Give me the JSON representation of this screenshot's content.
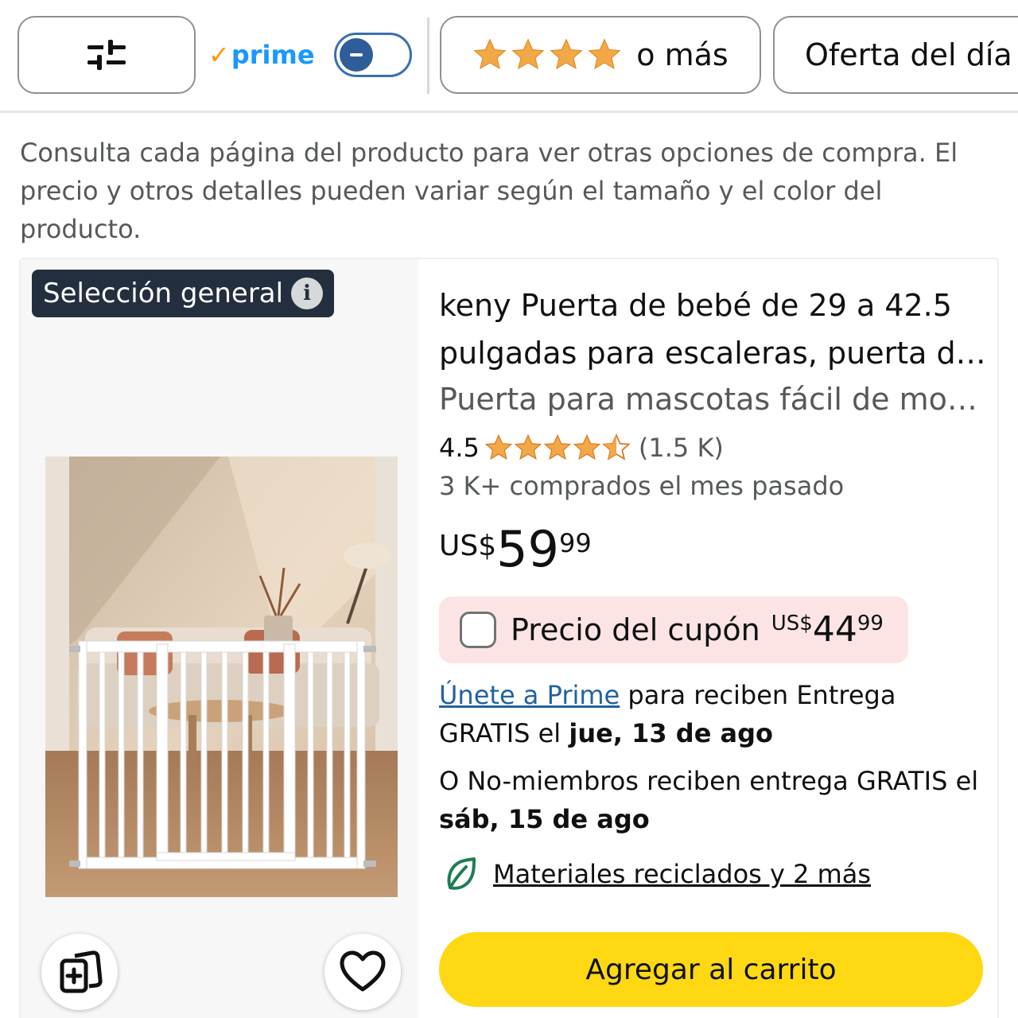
{
  "filter_bar": {
    "filters_icon": "sliders-icon",
    "prime_label": "prime",
    "prime_toggle_state": "off",
    "stars_label": "o más",
    "stars_count": 4,
    "deal_label": "Oferta del día"
  },
  "notice": "Consulta cada página del producto para ver otras opciones de compra. El precio y otros detalles pueden variar según el tamaño y el color del producto.",
  "product": {
    "badge": "Selección general",
    "title": "keny Puerta de bebé de 29 a 42.5 pulgadas para escaleras, puerta d…",
    "subtitle": "Puerta para mascotas fácil de mo…",
    "rating": "4.5",
    "rating_value": 4.5,
    "rating_count": "(1.5 K)",
    "bought": "3 K+ comprados el mes pasado",
    "price": {
      "symbol": "US$",
      "whole": "59",
      "fraction": "99"
    },
    "coupon": {
      "label": "Precio del cupón",
      "symbol": "US$",
      "whole": "44",
      "fraction": "99"
    },
    "delivery": {
      "prime_link": "Únete a Prime",
      "text1": " para reciben Entrega GRATIS el ",
      "date1": "jue, 13 de ago",
      "text2": "O No-miembros reciben entrega GRATIS el ",
      "date2": "sáb, 15 de ago"
    },
    "eco_link": "Materiales reciclados y 2 más",
    "cart_button": "Agregar al carrito"
  },
  "colors": {
    "star": "#f3a847",
    "prime_blue": "#1a98ff",
    "link": "#2162a1",
    "cart_yellow": "#ffd814",
    "coupon_bg": "#fce4e4",
    "badge_bg": "#232f3e",
    "eco_green": "#1b7e55"
  }
}
